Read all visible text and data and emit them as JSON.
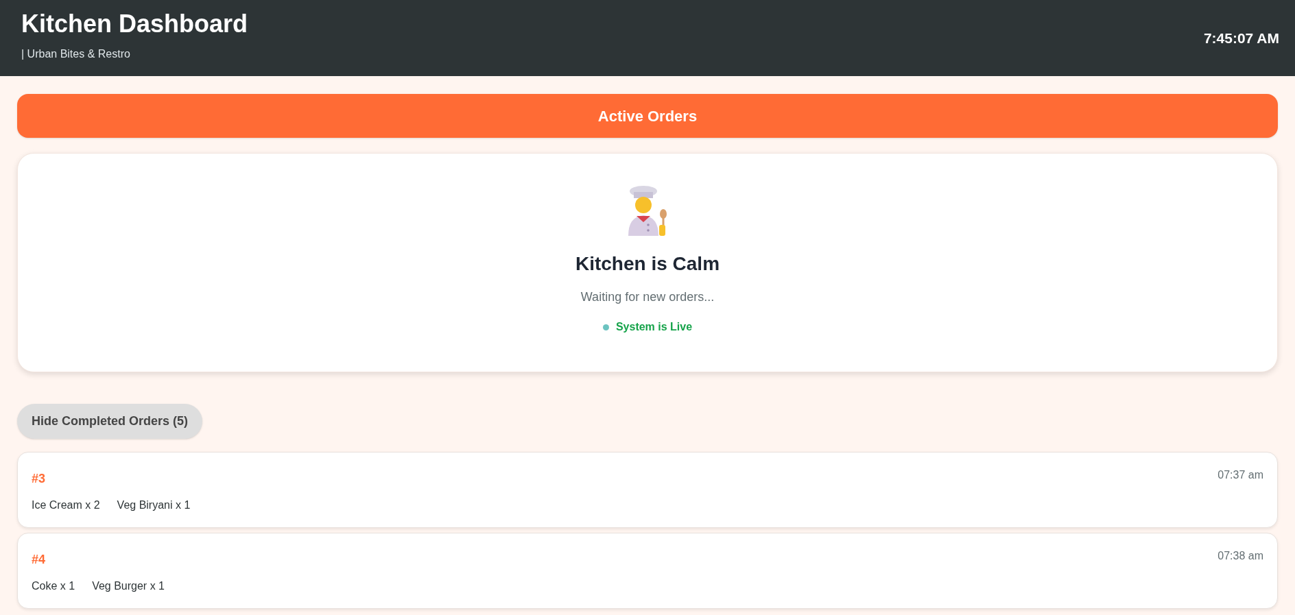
{
  "header": {
    "title": "Kitchen Dashboard",
    "subtitle": "| Urban Bites & Restro",
    "clock": "7:45:07 AM"
  },
  "section_title": "Active Orders",
  "empty_state": {
    "heading": "Kitchen is Calm",
    "message": "Waiting for new orders...",
    "status": {
      "label": "System is Live",
      "live": true,
      "color": "#6cc3c0"
    }
  },
  "toggle_button": {
    "label": "Hide Completed Orders (5)"
  },
  "completed_orders": [
    {
      "number": "#3",
      "time": "07:37 am",
      "items": [
        "Ice Cream x 2",
        "Veg Biryani x 1"
      ]
    },
    {
      "number": "#4",
      "time": "07:38 am",
      "items": [
        "Coke x 1",
        "Veg Burger x 1"
      ]
    }
  ]
}
